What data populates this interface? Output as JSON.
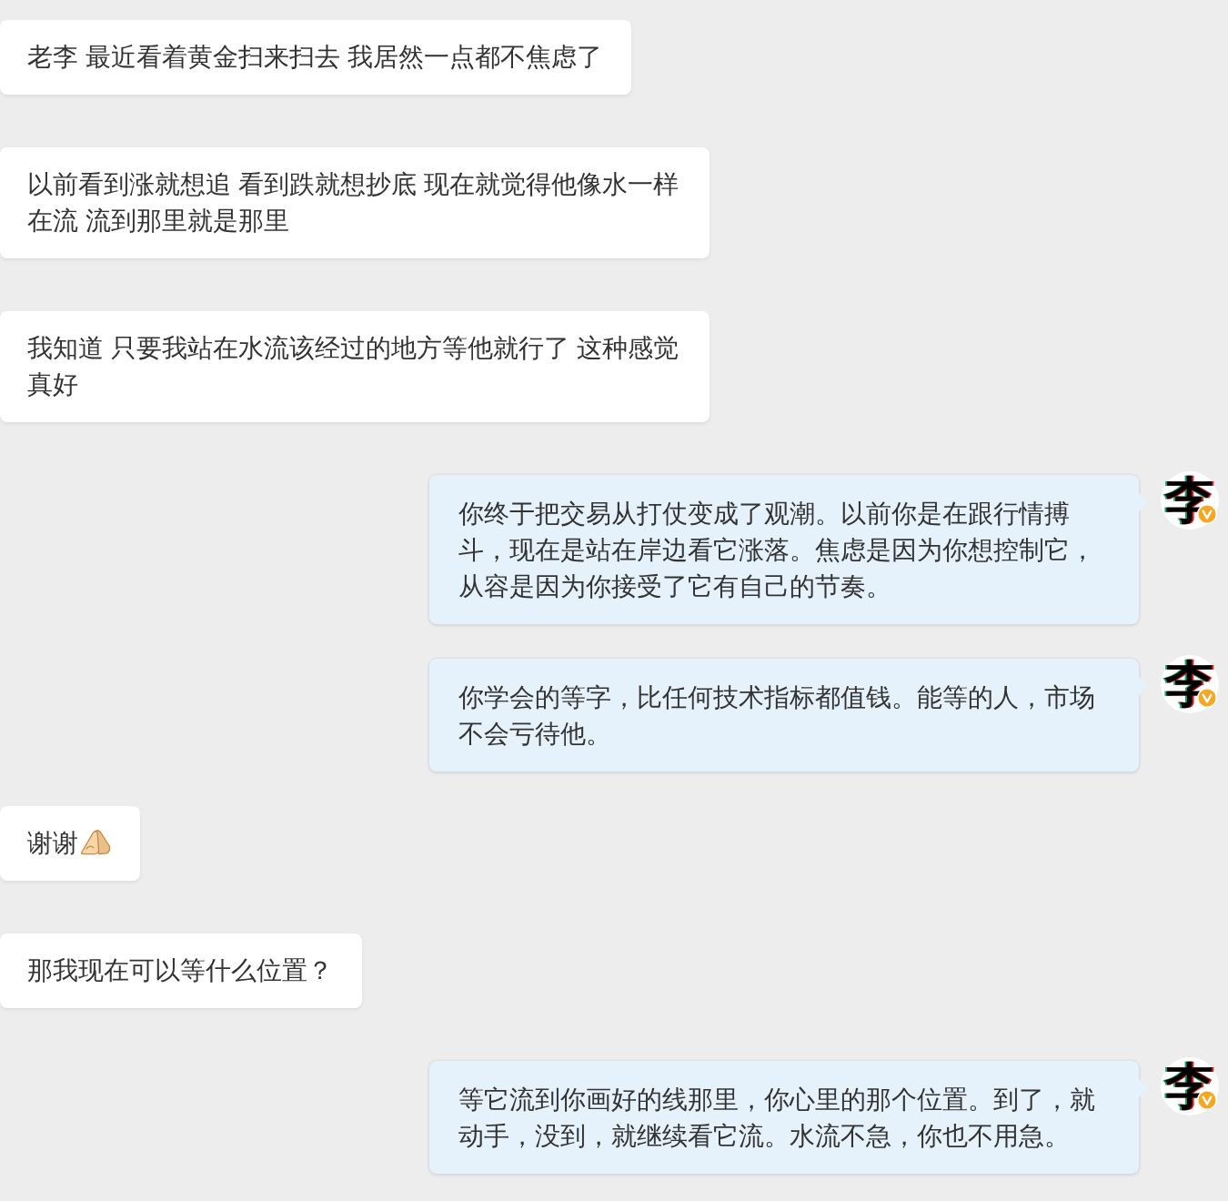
{
  "messages": [
    {
      "kind": "received",
      "text": "老李 最近看着黄金扫来扫去 我居然一点都不焦虑了"
    },
    {
      "kind": "received",
      "text": "以前看到涨就想追 看到跌就想抄底 现在就觉得他像水一样在流 流到那里就是那里"
    },
    {
      "kind": "received",
      "text": "我知道 只要我站在水流该经过的地方等他就行了 这种感觉真好"
    },
    {
      "kind": "sent",
      "text": "你终于把交易从打仗变成了观潮。以前你是在跟行情搏斗，现在是站在岸边看它涨落。焦虑是因为你想控制它，从容是因为你接受了它有自己的节奏。",
      "avatar": {
        "glyph": "李",
        "verified": true
      }
    },
    {
      "kind": "sent",
      "text": "你学会的等字，比任何技术指标都值钱。能等的人，市场不会亏待他。",
      "avatar": {
        "glyph": "李",
        "verified": true
      }
    },
    {
      "kind": "received",
      "text": "谢谢",
      "emoji": true
    },
    {
      "kind": "received",
      "text": "那我现在可以等什么位置？"
    },
    {
      "kind": "sent",
      "text": "等它流到你画好的线那里，你心里的那个位置。到了，就动手，没到，就继续看它流。水流不急，你也不用急。",
      "avatar": {
        "glyph": "李",
        "verified": true
      }
    }
  ]
}
